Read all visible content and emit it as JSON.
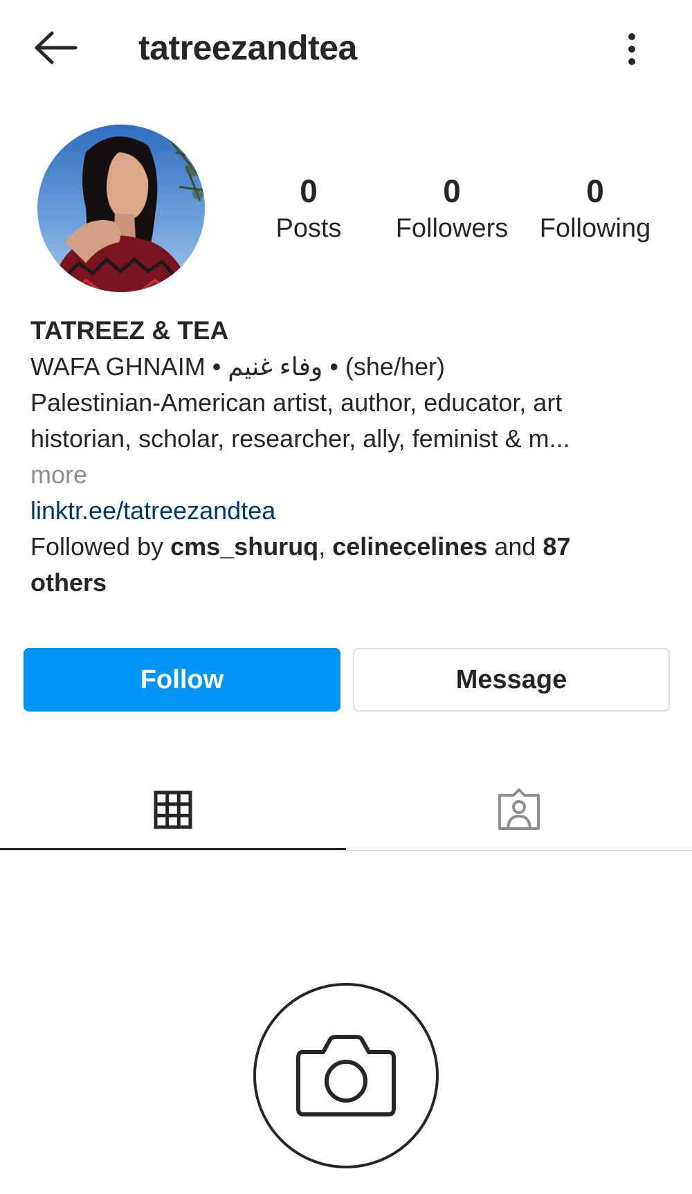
{
  "header": {
    "username": "tatreezandtea",
    "back_icon": "arrow-left-icon",
    "menu_icon": "more-vertical-icon"
  },
  "profile": {
    "avatar_description_icon": "profile-photo",
    "stats": [
      {
        "value": "0",
        "label": "Posts"
      },
      {
        "value": "0",
        "label": "Followers"
      },
      {
        "value": "0",
        "label": "Following"
      }
    ]
  },
  "bio": {
    "name": "TATREEZ & TEA",
    "subtitle": "WAFA GHNAIM • وفاء غنيم • (she/her)",
    "line1": "Palestinian-American artist, author, educator, art",
    "line2": "historian, scholar, researcher, ally, feminist & m...",
    "more": "more",
    "link": "linktr.ee/tatreezandtea",
    "followed_by_prefix": "Followed by ",
    "follower_1": "cms_shuruq",
    "separator": ", ",
    "follower_2": "celinecelines",
    "and_text": " and ",
    "others_count": "87",
    "others_word": "others"
  },
  "actions": {
    "follow_label": "Follow",
    "message_label": "Message"
  },
  "tabs": {
    "grid_icon": "grid-icon",
    "tagged_icon": "tagged-person-icon"
  },
  "empty_state": {
    "icon": "camera-icon"
  },
  "colors": {
    "primary_blue": "#0095f6",
    "link_blue": "#00376b",
    "text": "#262626",
    "muted": "#8e8e8e",
    "border": "#dbdbdb"
  }
}
